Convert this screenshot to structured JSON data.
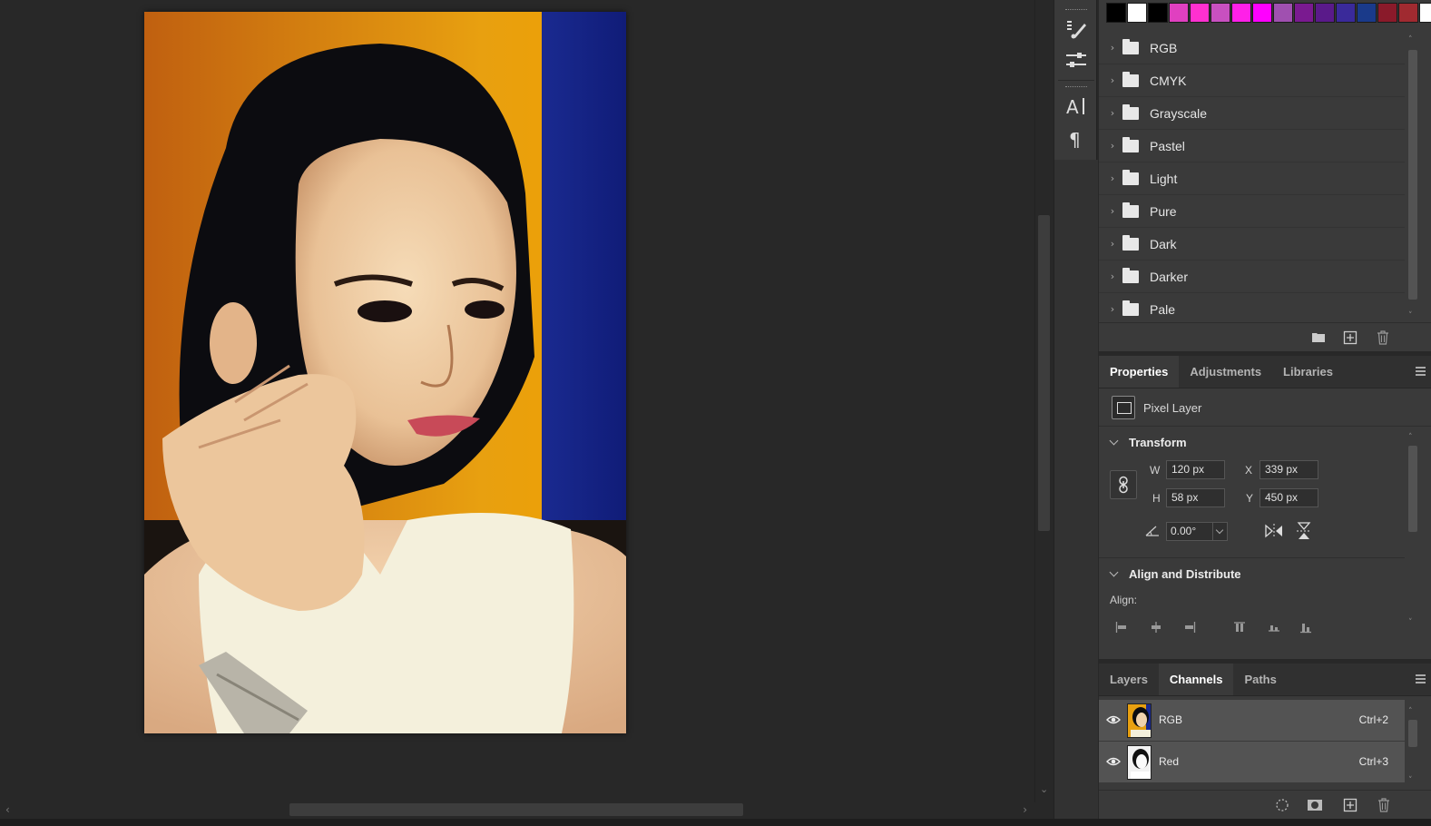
{
  "document": {
    "alt": "Portrait photo of a woman resting her chin on her hands"
  },
  "swatches": {
    "colors": [
      "#000000",
      "#ffffff",
      "#000000",
      "#e040c0",
      "#ff30d0",
      "#c850c0",
      "#ff20e8",
      "#ff00ff",
      "#a050b0",
      "#7a1a90",
      "#5a1a8a",
      "#3a2a9a",
      "#1a3a8a",
      "#8a1a2a",
      "#a02a30",
      "#ffffff"
    ],
    "folders": [
      "RGB",
      "CMYK",
      "Grayscale",
      "Pastel",
      "Light",
      "Pure",
      "Dark",
      "Darker",
      "Pale"
    ]
  },
  "properties": {
    "tabs": [
      "Properties",
      "Adjustments",
      "Libraries"
    ],
    "layer_type": "Pixel Layer",
    "transform": {
      "title": "Transform",
      "w_label": "W",
      "w_value": "120 px",
      "h_label": "H",
      "h_value": "58 px",
      "x_label": "X",
      "x_value": "339 px",
      "y_label": "Y",
      "y_value": "450 px",
      "angle_value": "0.00°"
    },
    "align": {
      "title": "Align and Distribute",
      "label": "Align:"
    }
  },
  "channels": {
    "tabs": [
      "Layers",
      "Channels",
      "Paths"
    ],
    "rows": [
      {
        "name": "RGB",
        "shortcut": "Ctrl+2"
      },
      {
        "name": "Red",
        "shortcut": "Ctrl+3"
      }
    ]
  }
}
